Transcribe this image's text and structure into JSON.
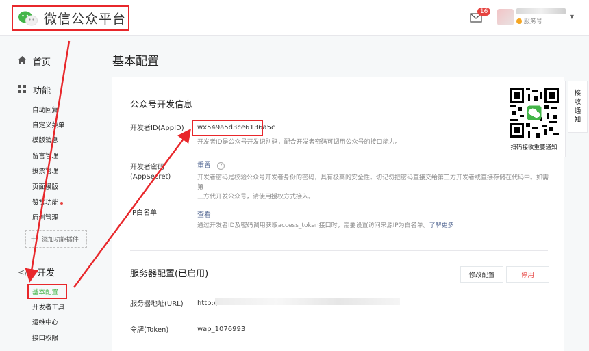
{
  "header": {
    "logo_text": "微信公众平台",
    "notify_count": "16",
    "account_type": "服务号"
  },
  "sidebar": {
    "home": "首页",
    "features": "功能",
    "feature_items": [
      "自动回复",
      "自定义菜单",
      "模版消息",
      "留言管理",
      "投票管理",
      "页面模版",
      "赞赏功能",
      "原创管理"
    ],
    "add_plugin": "添加功能插件",
    "develop": "开发",
    "develop_items": [
      "基本配置",
      "开发者工具",
      "运维中心",
      "接口权限"
    ]
  },
  "main": {
    "page_title": "基本配置",
    "dev_info": {
      "title": "公众号开发信息",
      "appid_label": "开发者ID(AppID)",
      "appid_value": "wx549a5d3ce6136a5c",
      "appid_desc": "开发者ID是公众号开发识别码，配合开发者密码可调用公众号的接口能力。",
      "secret_label_line1": "开发者密码",
      "secret_label_line2": "(AppSecret)",
      "secret_action": "重置",
      "secret_help": "?",
      "secret_desc_line1": "开发者密码是校验公众号开发者身份的密码，具有极高的安全性。切记勿把密码直接交给第三方开发者或直接存储在代码中。如需第",
      "secret_desc_line2": "三方代开发公众号，请使用授权方式接入。",
      "ip_label": "IP白名单",
      "ip_action": "查看",
      "ip_desc": "通过开发者ID及密码调用获取access_token接口时，需要设置访问来源IP为白名单。",
      "ip_more": "了解更多"
    },
    "server": {
      "title": "服务器配置(已启用)",
      "edit_button": "修改配置",
      "disable_button": "停用",
      "url_label": "服务器地址(URL)",
      "url_value": "http://l",
      "token_label": "令牌(Token)",
      "token_value": "wap_1076993"
    }
  },
  "qr_panel": {
    "caption": "扫码接收重要通知",
    "notify_tab_chars": [
      "接",
      "收",
      "通",
      "知"
    ]
  },
  "colors": {
    "annotation_red": "#e8272b",
    "wechat_green": "#44b549",
    "link_blue": "#576b95",
    "danger_red": "#e64340"
  }
}
